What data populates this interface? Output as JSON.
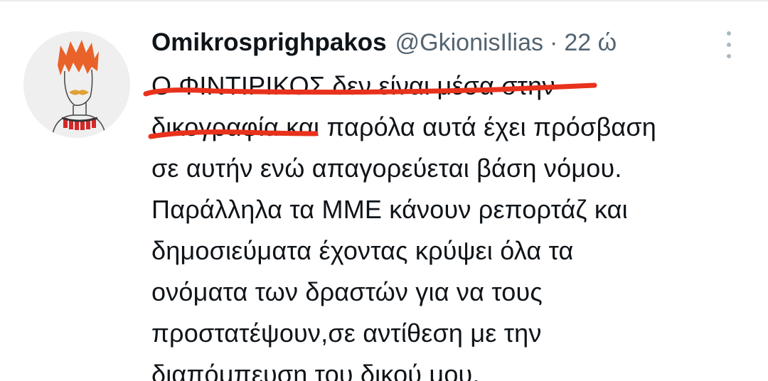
{
  "tweet": {
    "display_name": "Omikrosprighpakos",
    "handle": "@GkionisIlias",
    "separator": "·",
    "time": "22 ώ",
    "text_lines": [
      "Ο ΦΙΝΤΙΡΙΚΟΣ δεν είναι μέσα στην",
      "δικογραφία και παρόλα αυτά έχει πρόσβαση",
      "σε αυτήν ενώ απαγορεύεται βάση νόμου.",
      "Παράλληλα τα ΜΜΕ κάνουν ρεπορτάζ και",
      "δημοσιεύματα έχοντας κρύψει όλα τα",
      "ονόματα των δραστών για να τους",
      "προστατέψουν,σε αντίθεση με την",
      "διαπόμπευση του δικού μου."
    ]
  },
  "icons": {
    "more": "more-options-icon",
    "avatar": "avatar-illustration"
  },
  "colors": {
    "text": "#0f1419",
    "secondary": "#536471",
    "annotation_red": "#e8321c"
  }
}
